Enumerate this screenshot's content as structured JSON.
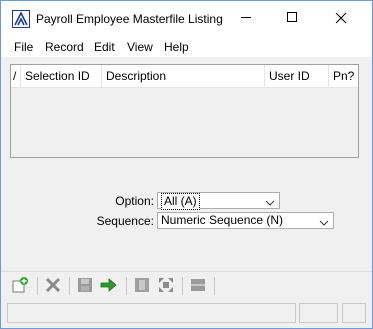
{
  "window": {
    "title": "Payroll Employee Masterfile Listing",
    "controls": [
      "minimize-icon",
      "maximize-icon",
      "close-icon"
    ]
  },
  "menu": {
    "items": [
      "File",
      "Record",
      "Edit",
      "View",
      "Help"
    ]
  },
  "grid": {
    "columns": [
      "/",
      "Selection ID",
      "Description",
      "User ID",
      "Pn?"
    ],
    "rows": []
  },
  "form": {
    "option_label": "Option:",
    "option_value": "All (A)",
    "sequence_label": "Sequence:",
    "sequence_value": "Numeric Sequence (N)"
  },
  "toolbar": {
    "buttons": [
      "new-record-icon",
      "delete-icon",
      "save-icon",
      "go-arrow-icon",
      "list-icon",
      "expand-icon",
      "panel-icon"
    ]
  },
  "colors": {
    "accent_border": "#6b9bd1",
    "app_icon_blue": "#1f3c88",
    "go_arrow_green": "#2e9a2e",
    "new_icon_green": "#3aa335"
  }
}
